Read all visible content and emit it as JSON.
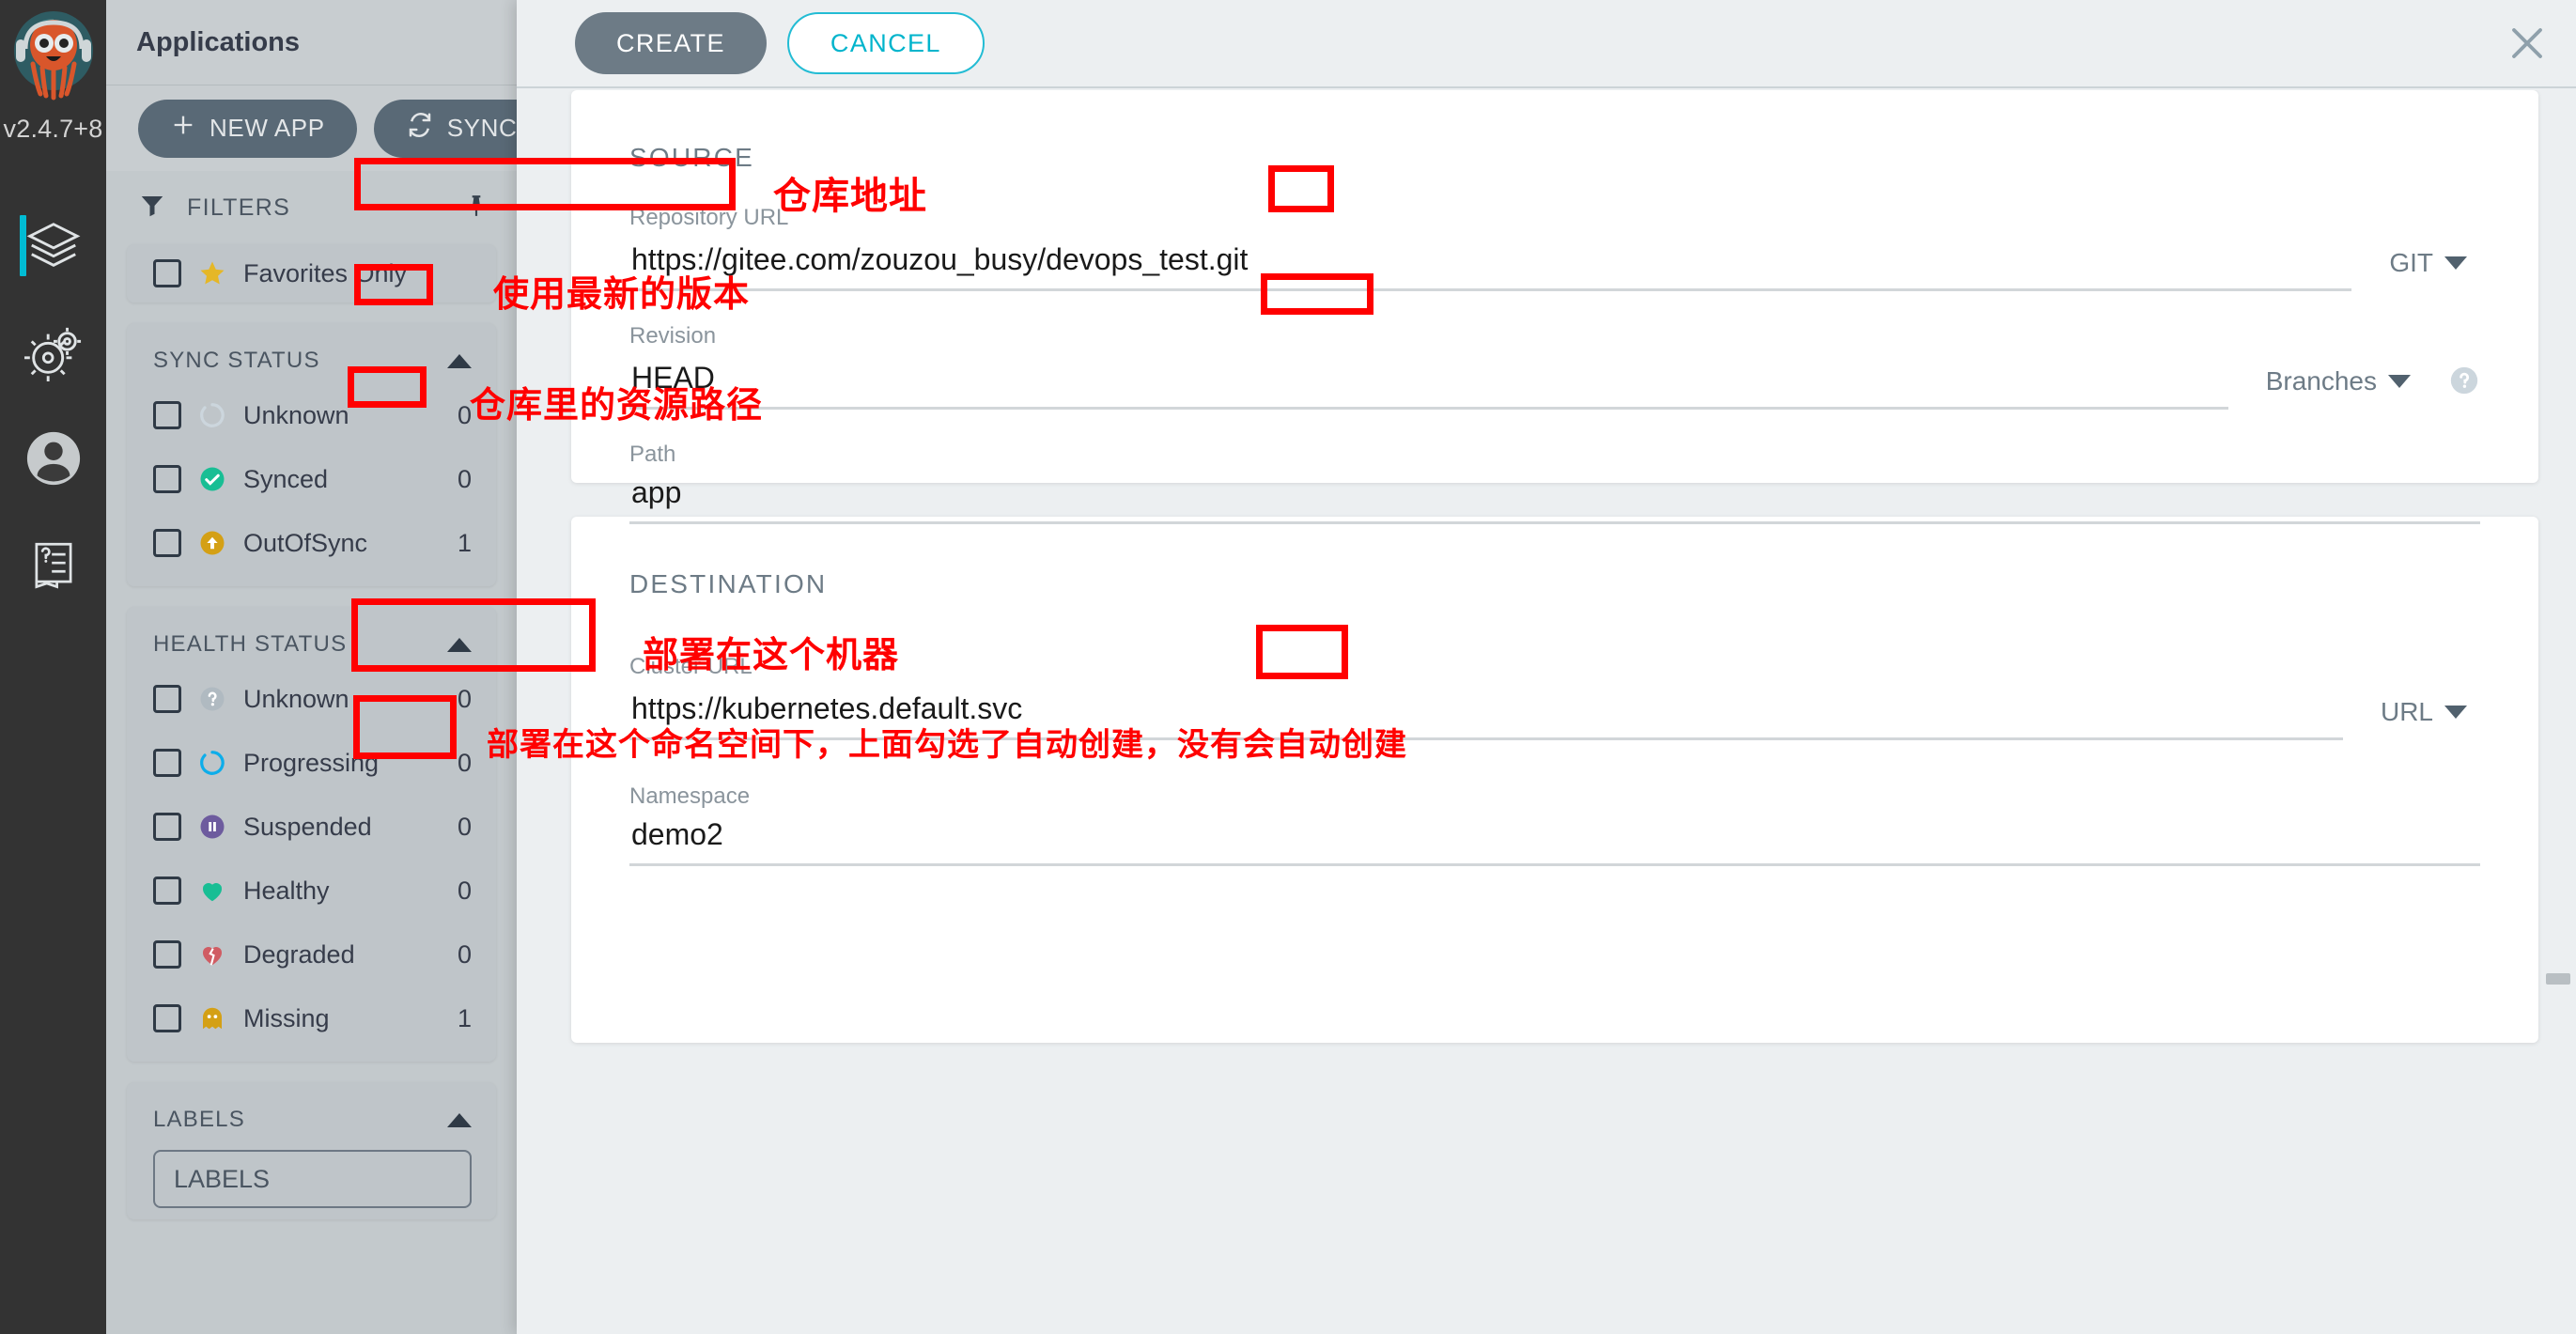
{
  "rail": {
    "version": "v2.4.7+8",
    "items": [
      {
        "name": "applications",
        "icon": "layers-icon",
        "active": true
      },
      {
        "name": "settings",
        "icon": "gear-icon",
        "active": false
      },
      {
        "name": "user-info",
        "icon": "user-icon",
        "active": false
      },
      {
        "name": "documentation",
        "icon": "book-help-icon",
        "active": false
      }
    ]
  },
  "sidebar": {
    "title": "Applications",
    "buttons": [
      {
        "label": "NEW APP",
        "icon": "plus-icon"
      },
      {
        "label": "SYNC APPS",
        "icon": "sync-icon"
      }
    ],
    "filters_header": "FILTERS",
    "favorites": {
      "label": "Favorites Only",
      "icon": "star-icon",
      "checked": false
    },
    "sync_status": {
      "header": "SYNC STATUS",
      "items": [
        {
          "label": "Unknown",
          "count": "0",
          "icon": "circle-unknown-icon",
          "color": "#ccd6dd"
        },
        {
          "label": "Synced",
          "count": "0",
          "icon": "check-circle-icon",
          "color": "#18be94"
        },
        {
          "label": "OutOfSync",
          "count": "1",
          "icon": "arrow-up-circle-icon",
          "color": "#d4a015"
        }
      ]
    },
    "health_status": {
      "header": "HEALTH STATUS",
      "items": [
        {
          "label": "Unknown",
          "count": "0",
          "icon": "question-circle-icon",
          "color": "#b0bac1"
        },
        {
          "label": "Progressing",
          "count": "0",
          "icon": "progress-circle-icon",
          "color": "#0dadea"
        },
        {
          "label": "Suspended",
          "count": "0",
          "icon": "pause-circle-icon",
          "color": "#6d5b9e"
        },
        {
          "label": "Healthy",
          "count": "0",
          "icon": "heart-icon",
          "color": "#18be94"
        },
        {
          "label": "Degraded",
          "count": "0",
          "icon": "heart-broken-icon",
          "color": "#d05c63"
        },
        {
          "label": "Missing",
          "count": "1",
          "icon": "ghost-icon",
          "color": "#d4a015"
        }
      ]
    },
    "labels": {
      "header": "LABELS",
      "input_placeholder": "LABELS"
    }
  },
  "panel": {
    "create_label": "CREATE",
    "cancel_label": "CANCEL",
    "close_icon": "close-icon",
    "source": {
      "title": "SOURCE",
      "repository_url": {
        "label": "Repository URL",
        "value": "https://gitee.com/zouzou_busy/devops_test.git",
        "selector": "GIT"
      },
      "revision": {
        "label": "Revision",
        "value": "HEAD",
        "selector": "Branches",
        "help_icon": "question-help-icon"
      },
      "path": {
        "label": "Path",
        "value": "app"
      }
    },
    "destination": {
      "title": "DESTINATION",
      "cluster_url": {
        "label": "Cluster URL",
        "value": "https://kubernetes.default.svc",
        "selector": "URL"
      },
      "namespace": {
        "label": "Namespace",
        "value": "demo2"
      }
    }
  },
  "annotations": {
    "color": "#ff0000",
    "notes": [
      {
        "id": "repo-note",
        "text": "仓库地址"
      },
      {
        "id": "revision-note",
        "text": "使用最新的版本"
      },
      {
        "id": "path-note",
        "text": "仓库里的资源路径"
      },
      {
        "id": "cluster-note",
        "text": "部署在这个机器"
      },
      {
        "id": "namespace-note",
        "text": "部署在这个命名空间下，上面勾选了自动创建，没有会自动创建"
      }
    ]
  }
}
